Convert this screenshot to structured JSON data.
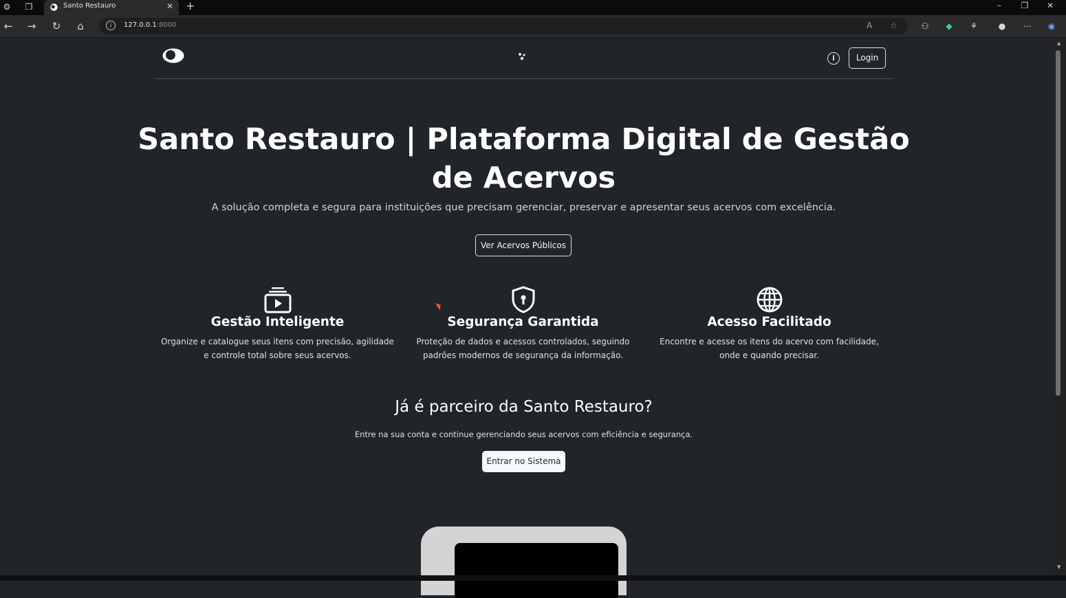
{
  "browser": {
    "tab_title": "Santo Restauro",
    "tab_close": "✕",
    "new_tab": "+",
    "url_host": "127.0.0.1",
    "url_port": ":8000"
  },
  "navbar": {
    "login_label": "Login",
    "info_icon": "i"
  },
  "hero": {
    "title": "Santo Restauro | Plataforma Digital de Gestão de Acervos",
    "subtitle": "A solução completa e segura para instituições que precisam gerenciar, preservar e apresentar seus acervos com excelência.",
    "cta_label": "Ver Acervos Públicos"
  },
  "features": [
    {
      "icon": "collection-play-icon",
      "title": "Gestão Inteligente",
      "description": "Organize e catalogue seus itens com precisão, agilidade e controle total sobre seus acervos."
    },
    {
      "icon": "shield-lock-icon",
      "title": "Segurança Garantida",
      "description": "Proteção de dados e acessos controlados, seguindo padrões modernos de segurança da informação."
    },
    {
      "icon": "globe-icon",
      "title": "Acesso Facilitado",
      "description": "Encontre e acesse os itens do acervo com facilidade, onde e quando precisar."
    }
  ],
  "partner": {
    "title": "Já é parceiro da Santo Restauro?",
    "subtitle": "Entre na sua conta e continue gerenciando seus acervos com eficiência e segurança.",
    "button_label": "Entrar no Sistema"
  },
  "colors": {
    "page_bg": "#212529",
    "text": "#f8f9fa",
    "button_light": "#f8f9fa"
  }
}
